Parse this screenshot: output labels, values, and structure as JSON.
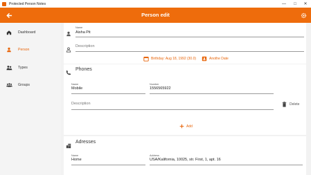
{
  "window": {
    "title": "Protected Person Notes"
  },
  "appbar": {
    "title": "Person edit"
  },
  "sidebar": {
    "items": [
      {
        "label": "Dashboard"
      },
      {
        "label": "Person"
      },
      {
        "label": "Types"
      },
      {
        "label": "Groups"
      }
    ]
  },
  "person": {
    "name_label": "Name",
    "name_value": "Aisha Pit",
    "description_placeholder": "Description",
    "birthday": "Birthday: Aug 18, 1992 (30.0)",
    "another_date": "Anothe Date"
  },
  "phones": {
    "title": "Phones",
    "name_label": "Name",
    "name_value": "Mobile",
    "number_label": "Number",
    "number_value": "1556565922",
    "description_placeholder": "Description",
    "delete_label": "Delete",
    "add_label": "Add"
  },
  "addresses": {
    "title": "Adresses",
    "name_label": "Name",
    "name_value": "Home",
    "address_label": "Address",
    "address_value": "USA/Kalifornia, 10025, str. First, 1, apt. 16"
  },
  "colors": {
    "accent": "#ee6c0c",
    "active_text": "#e8650a"
  }
}
